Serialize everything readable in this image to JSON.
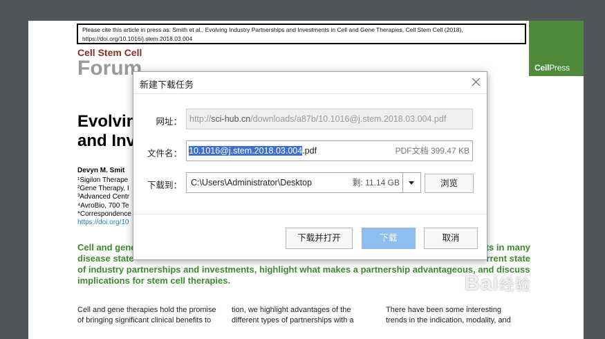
{
  "pdf": {
    "cite_line1": "Please cite this article in press as: Smith et al., Evolving Industry Partnerships and Investments in Cell and Gene Therapies, Cell Stem Cell (2018),",
    "cite_line2": "https://doi.org/10.1016/j.stem.2018.03.004",
    "publisher_bold": "Cell",
    "publisher_light": "Press",
    "journal": "Cell Stem Cell",
    "section": "Forum",
    "title_line1": "Evolvir",
    "title_line2": "and Inv",
    "author": "Devyn M. Smit",
    "affiliations": [
      "¹Sigilon Therape",
      "²Gene Therapy, I",
      "³Advanced Centr",
      "⁴AvroBio, 700 Te",
      "*Correspondence"
    ],
    "doi_short": "https://doi.org/10",
    "abstract_row1_left": "Cell and gene",
    "abstract_row1_right": "ts in many",
    "abstract_row2_left": "disease state",
    "abstract_row2_right": "rrent state",
    "abstract_row3": "of industry partnerships and investments, highlight what makes a partnership advantageous, and discuss",
    "abstract_row4": "implications for stem cell therapies.",
    "col1_line1": "Cell and gene therapies hold the promise",
    "col1_line2": "of bringing significant clinical benefits to",
    "col2_line1": "tion, we highlight advantages of the",
    "col2_line2": "different types of partnerships with a",
    "col3_line1": "There have been some interesting",
    "col3_line2": "trends in the indication, modality, and"
  },
  "dialog": {
    "title": "新建下载任务",
    "url_label": "网址：",
    "url_prefix": "http://",
    "url_host": "sci-hub.cn",
    "url_path": "/downloads/a87b/10.1016@j.stem.2018.03.004.pdf",
    "filename_label": "文件名：",
    "filename_selected": "10.1016@j.stem.2018.03.004",
    "filename_ext": ".pdf",
    "file_meta": "PDF文档 399.47 KB",
    "dest_label": "下载到：",
    "dest_path": "C:\\Users\\Administrator\\Desktop",
    "free_space": "剩: 11.14 GB",
    "browse_label": "浏览",
    "download_open_label": "下载并打开",
    "download_label": "下载",
    "cancel_label": "取消"
  },
  "watermark": {
    "text": "Bai",
    "suffix": "经验"
  },
  "colors": {
    "viewer_bg": "#525659",
    "journal_red": "#8c2b1e",
    "cellpress_green": "#4e8a3a",
    "abstract_green": "#3c8a2e",
    "selection_blue": "#3f6fd1",
    "primary_button": "#8ebef0"
  }
}
